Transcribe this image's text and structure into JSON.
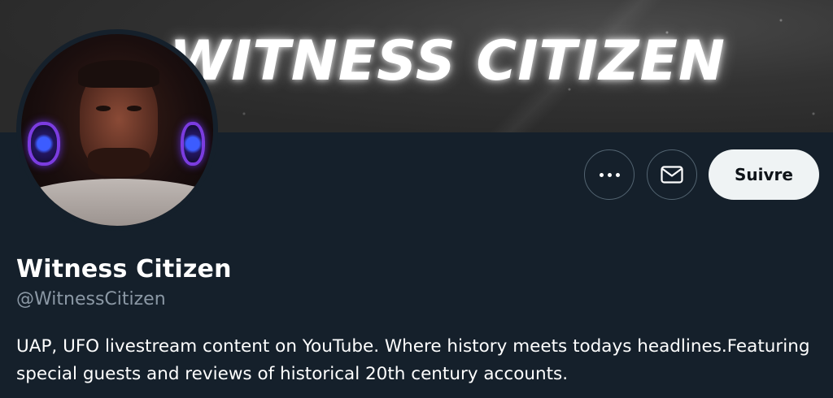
{
  "banner": {
    "title": "WITNESS CITIZEN"
  },
  "profile": {
    "display_name": "Witness Citizen",
    "handle": "@WitnessCitizen",
    "bio": "UAP, UFO livestream content on YouTube. Where history meets todays headlines.Featuring special guests and reviews of historical 20th century accounts."
  },
  "actions": {
    "more_icon": "more-horizontal-icon",
    "message_icon": "envelope-icon",
    "follow_label": "Suivre"
  },
  "colors": {
    "background": "#15202b",
    "text_primary": "#ffffff",
    "text_secondary": "#8b98a5",
    "button_border": "#536471",
    "follow_button_bg": "#eff3f4",
    "follow_button_text": "#0f1419"
  }
}
